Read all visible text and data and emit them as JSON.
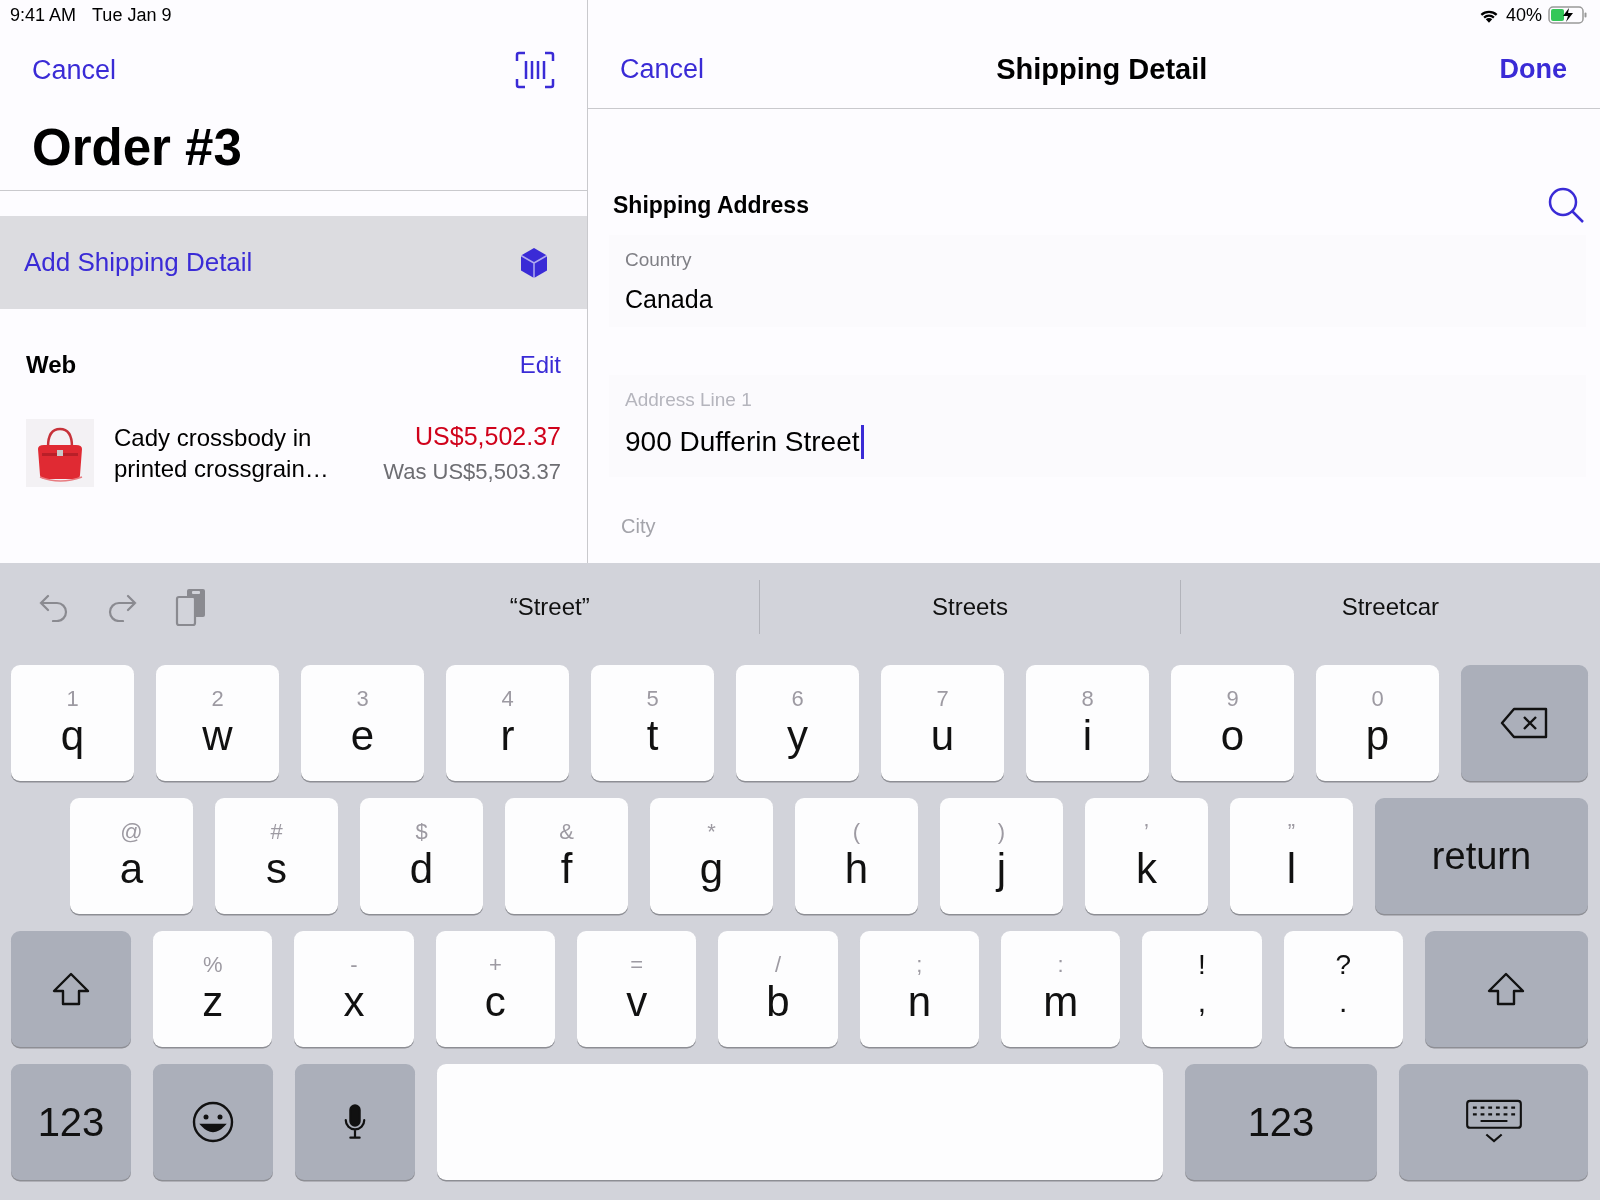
{
  "status_bar": {
    "time": "9:41 AM",
    "date": "Tue Jan 9",
    "battery": "40%"
  },
  "left_pane": {
    "nav": {
      "cancel": "Cancel"
    },
    "title": "Order #3",
    "add_shipping": "Add Shipping Detail",
    "section": {
      "title": "Web",
      "action": "Edit"
    },
    "items": [
      {
        "kind": "picture",
        "name": "Cady crossbody in printed crossgrain…",
        "price": "US$5,502.37",
        "was_price": "Was US$5,503.37"
      }
    ]
  },
  "right_pane": {
    "nav": {
      "cancel": "Cancel",
      "title": "Shipping Detail",
      "done": "Done"
    },
    "section_title": "Shipping Address",
    "fields": [
      {
        "label": "Country",
        "value": "Canada",
        "focused": false
      },
      {
        "label": "Address Line 1",
        "value": "900 Dufferin Street",
        "focused": true
      }
    ],
    "next_field_label": "City"
  },
  "keyboard": {
    "suggestions": [
      {
        "text": "“Street”",
        "selected": false
      },
      {
        "text": "Streets",
        "selected": false
      },
      {
        "text": "Streetcar",
        "selected": false
      }
    ],
    "rows": [
      [
        {
          "kind": "letter",
          "hint": "1",
          "label": "q"
        },
        {
          "kind": "letter",
          "hint": "2",
          "label": "w"
        },
        {
          "kind": "letter",
          "hint": "3",
          "label": "e"
        },
        {
          "kind": "letter",
          "hint": "4",
          "label": "r"
        },
        {
          "kind": "letter",
          "hint": "5",
          "label": "t"
        },
        {
          "kind": "letter",
          "hint": "6",
          "label": "y"
        },
        {
          "kind": "letter",
          "hint": "7",
          "label": "u"
        },
        {
          "kind": "letter",
          "hint": "8",
          "label": "i"
        },
        {
          "kind": "letter",
          "hint": "9",
          "label": "o"
        },
        {
          "kind": "letter",
          "hint": "0",
          "label": "p"
        },
        {
          "kind": "delete"
        }
      ],
      [
        {
          "kind": "letter",
          "hint": "@",
          "label": "a"
        },
        {
          "kind": "letter",
          "hint": "#",
          "label": "s"
        },
        {
          "kind": "letter",
          "hint": "$",
          "label": "d"
        },
        {
          "kind": "letter",
          "hint": "&",
          "label": "f"
        },
        {
          "kind": "letter",
          "hint": "*",
          "label": "g"
        },
        {
          "kind": "letter",
          "hint": "(",
          "label": "h"
        },
        {
          "kind": "letter",
          "hint": ")",
          "label": "j"
        },
        {
          "kind": "letter",
          "hint": "’",
          "label": "k"
        },
        {
          "kind": "letter",
          "hint": "”",
          "label": "l"
        },
        {
          "kind": "return",
          "label": "return"
        }
      ],
      [
        {
          "kind": "shift"
        },
        {
          "kind": "letter",
          "hint": "%",
          "label": "z"
        },
        {
          "kind": "letter",
          "hint": "-",
          "label": "x"
        },
        {
          "kind": "letter",
          "hint": "+",
          "label": "c"
        },
        {
          "kind": "letter",
          "hint": "=",
          "label": "v"
        },
        {
          "kind": "letter",
          "hint": "/",
          "label": "b"
        },
        {
          "kind": "letter",
          "hint": ";",
          "label": "n"
        },
        {
          "kind": "letter",
          "hint": ":",
          "label": "m"
        },
        {
          "kind": "punct",
          "hint": "!",
          "label": ","
        },
        {
          "kind": "punct",
          "hint": "?",
          "label": "."
        },
        {
          "kind": "shift"
        }
      ],
      [
        {
          "kind": "numbers",
          "label": "123"
        },
        {
          "kind": "emoji"
        },
        {
          "kind": "mic"
        },
        {
          "kind": "space"
        },
        {
          "kind": "numbers",
          "label": "123"
        },
        {
          "kind": "hide"
        }
      ]
    ]
  }
}
